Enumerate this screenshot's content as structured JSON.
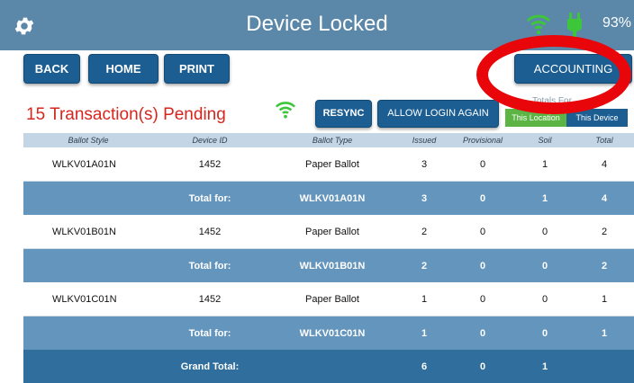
{
  "header": {
    "title": "Device Locked",
    "battery": "93%",
    "icons": [
      "gear-icon",
      "wifi-icon",
      "plug-icon"
    ],
    "wifi_color": "#3ec63a",
    "plug_color": "#3ec63a"
  },
  "nav": {
    "back_label": "BACK",
    "home_label": "HOME",
    "print_label": "PRINT",
    "accounting_label": "ACCOUNTING"
  },
  "status": {
    "pending_text": "15 Transaction(s) Pending",
    "pending_color": "#d6261e"
  },
  "actions": {
    "resync_label": "RESYNC",
    "allow_login_label": "ALLOW LOGIN AGAIN"
  },
  "totals_toggle": {
    "label": "Totals For",
    "options": [
      "This Location",
      "This Device"
    ],
    "selected": "This Location",
    "selected_color": "#5bb443"
  },
  "table": {
    "columns": [
      "Ballot Style",
      "Device ID",
      "Ballot Type",
      "Issued",
      "Provisional",
      "Soil",
      "Total"
    ],
    "rows": [
      {
        "kind": "data",
        "cells": [
          "WLKV01A01N",
          "1452",
          "Paper Ballot",
          "3",
          "0",
          "1",
          "4"
        ]
      },
      {
        "kind": "sub",
        "cells": [
          "",
          "Total for:",
          "WLKV01A01N",
          "3",
          "0",
          "1",
          "4"
        ]
      },
      {
        "kind": "data",
        "cells": [
          "WLKV01B01N",
          "1452",
          "Paper Ballot",
          "2",
          "0",
          "0",
          "2"
        ]
      },
      {
        "kind": "sub",
        "cells": [
          "",
          "Total for:",
          "WLKV01B01N",
          "2",
          "0",
          "0",
          "2"
        ]
      },
      {
        "kind": "data",
        "cells": [
          "WLKV01C01N",
          "1452",
          "Paper Ballot",
          "1",
          "0",
          "0",
          "1"
        ]
      },
      {
        "kind": "sub",
        "cells": [
          "",
          "Total for:",
          "WLKV01C01N",
          "1",
          "0",
          "0",
          "1"
        ]
      },
      {
        "kind": "grand",
        "cells": [
          "",
          "Grand Total:",
          "",
          "6",
          "0",
          "1",
          ""
        ]
      }
    ]
  },
  "annotation": {
    "shape": "ellipse",
    "color": "#e8060b",
    "target": "accounting-button"
  }
}
